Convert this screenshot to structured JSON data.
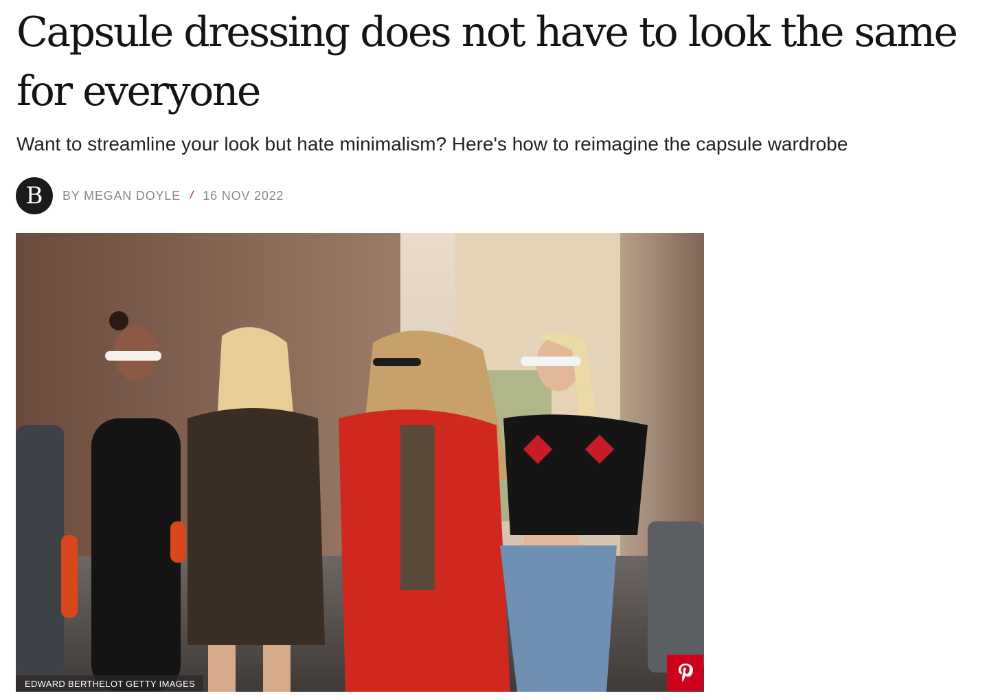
{
  "article": {
    "headline": "Capsule dressing does not have to look the same for everyone",
    "standfirst": "Want to streamline your look but hate minimalism? Here's how to reimagine the capsule wardrobe",
    "byline": {
      "logo_letter": "B",
      "author": "BY MEGAN DOYLE",
      "separator": "/",
      "date": "16 NOV 2022"
    },
    "hero_image": {
      "credit": "EDWARD BERTHELOT GETTY IMAGES",
      "pin_icon": "pinterest-icon"
    }
  },
  "colors": {
    "accent_red": "#d0021b",
    "logo_bg": "#1b1b1b",
    "meta_grey": "#8a8a8a"
  }
}
